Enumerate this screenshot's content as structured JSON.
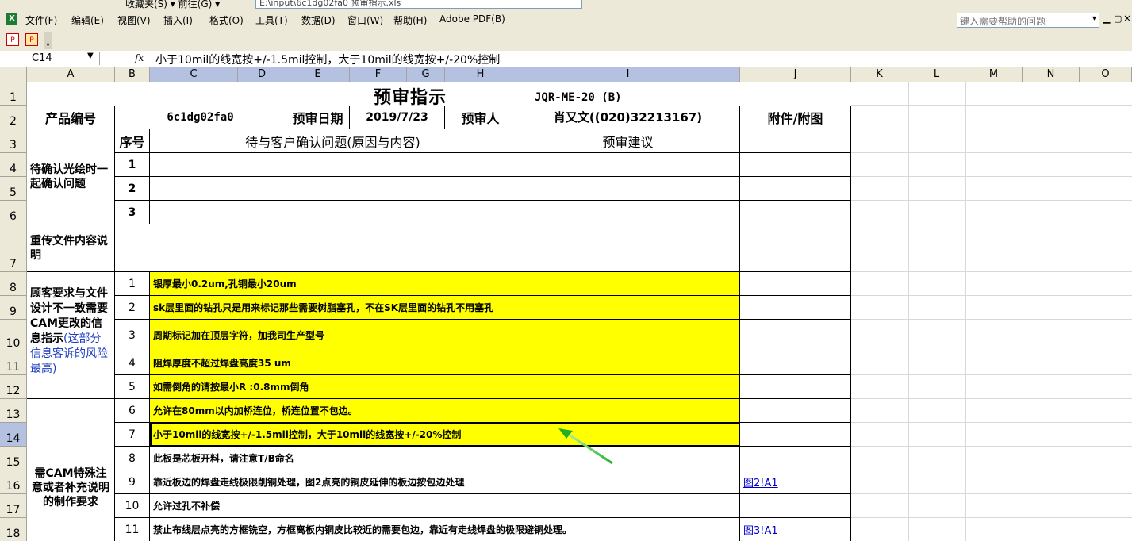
{
  "window": {
    "top_strip_text": "收藏夹(S) ▾  前往(G) ▾",
    "address_text": "E:\\input\\6c1dg02fa0 预审指示.xls"
  },
  "menubar": {
    "items": [
      "文件(F)",
      "编辑(E)",
      "视图(V)",
      "插入(I)",
      "格式(O)",
      "工具(T)",
      "数据(D)",
      "窗口(W)",
      "帮助(H)",
      "Adobe PDF(B)"
    ],
    "help_placeholder": "键入需要帮助的问题"
  },
  "formula_bar": {
    "name_box": "C14",
    "fx": "fx",
    "content": "小于10mil的线宽按+/-1.5mil控制，大于10mil的线宽按+/-20%控制"
  },
  "columns": [
    "A",
    "B",
    "C",
    "D",
    "E",
    "F",
    "G",
    "H",
    "I",
    "J",
    "K",
    "L",
    "M",
    "N",
    "O"
  ],
  "rows": [
    "1",
    "2",
    "3",
    "4",
    "5",
    "6",
    "7",
    "8",
    "9",
    "10",
    "11",
    "12",
    "13",
    "14",
    "15",
    "16",
    "17",
    "18"
  ],
  "sheet": {
    "title": "预审指示",
    "doc_code": "JQR-ME-20 (B)",
    "row2": {
      "product_no_label": "产品编号",
      "product_no": "6c1dg02fa0",
      "review_date_label": "预审日期",
      "review_date": "2019/7/23",
      "reviewer_label": "预审人",
      "reviewer": "肖又文((020)32213167)",
      "attachment_label": "附件/附图"
    },
    "row3": {
      "seq_label": "序号",
      "issue_label": "待与客户确认问题(原因与内容)",
      "suggest_label": "预审建议"
    },
    "confirm_section_label": "待确认光绘时一起确认问题",
    "confirm_seq": [
      "1",
      "2",
      "3"
    ],
    "resend_label": "重传文件内容说明",
    "mismatch_label_black": "顾客要求与文件设计不一致需要CAM更改的信息指示",
    "mismatch_label_blue": "(这部分信息客诉的风险最高)",
    "special_label": "需CAM特殊注意或者补充说明的制作要求",
    "items": [
      {
        "seq": "1",
        "text": "银厚最小0.2um,孔铜最小20um"
      },
      {
        "seq": "2",
        "text": "sk层里面的钻孔只是用来标记那些需要树脂塞孔，不在SK层里面的钻孔不用塞孔"
      },
      {
        "seq": "3",
        "text": "周期标记加在顶层字符，加我司生产型号"
      },
      {
        "seq": "4",
        "text": "阻焊厚度不超过焊盘高度35 um"
      },
      {
        "seq": "5",
        "text": "如需倒角的请按最小R :0.8mm倒角"
      },
      {
        "seq": "6",
        "text": "允许在80mm以内加桥连位，桥连位置不包边。"
      },
      {
        "seq": "7",
        "text": "小于10mil的线宽按+/-1.5mil控制，大于10mil的线宽按+/-20%控制"
      },
      {
        "seq": "8",
        "text": "此板是芯板开料，请注意T/B命名"
      },
      {
        "seq": "9",
        "text": "靠近板边的焊盘走线极限削铜处理，图2点亮的铜皮延伸的板边按包边处理",
        "link": "图2!A1"
      },
      {
        "seq": "10",
        "text": "允许过孔不补偿"
      },
      {
        "seq": "11",
        "text": "禁止布线层点亮的方框铣空，方框离板内铜皮比较近的需要包边，靠近有走线焊盘的极限避铜处理。",
        "link": "图3!A1"
      }
    ]
  },
  "colors": {
    "highlight": "#ffff00",
    "arrow": "#22b022",
    "selected_header": "#b5c1e0",
    "link": "#0000cc",
    "chrome": "#ece9d8"
  }
}
